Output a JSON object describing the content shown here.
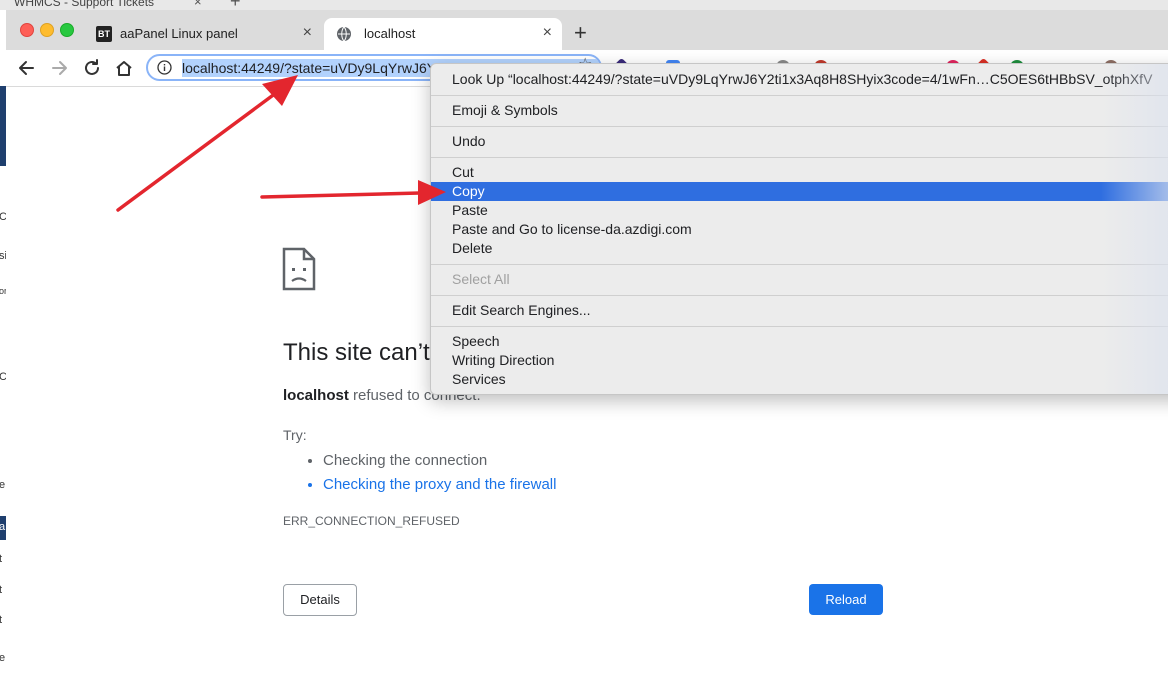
{
  "background_window": {
    "tab_title": "WHMCS - Support Tickets",
    "tab_close": "×",
    "new_tab": "+"
  },
  "browser": {
    "tabs": [
      {
        "favicon": "BT",
        "title": "aaPanel Linux panel",
        "close": "×",
        "active": false
      },
      {
        "favicon": "globe-icon",
        "title": "localhost",
        "close": "×",
        "active": true
      }
    ],
    "new_tab_label": "+",
    "address_bar": {
      "url": "localhost:44249/?state=uVDy9LqYrwJ6Y2ti1x3Aq8H8SHyix3code=4/1wFn",
      "selected": true,
      "star": "☆"
    }
  },
  "page": {
    "title": "This site can’t be reached",
    "host": "localhost",
    "host_suffix": " refused to connect.",
    "try_label": "Try:",
    "suggestions": [
      {
        "text": "Checking the connection",
        "link": false
      },
      {
        "text": "Checking the proxy and the firewall",
        "link": true
      }
    ],
    "error_code": "ERR_CONNECTION_REFUSED",
    "details_button": "Details",
    "reload_button": "Reload"
  },
  "context_menu": {
    "look_up": "Look Up “localhost:44249/?state=uVDy9LqYrwJ6Y2ti1x3Aq8H8SHyix3code=4/1wFn…C5OES6tHBbSV_otphXfV",
    "emoji": "Emoji & Symbols",
    "undo": "Undo",
    "cut": "Cut",
    "copy": "Copy",
    "paste": "Paste",
    "paste_go": "Paste and Go to license-da.azdigi.com",
    "delete": "Delete",
    "select_all": "Select All",
    "edit_search": "Edit Search Engines...",
    "speech": "Speech",
    "writing_direction": "Writing Direction",
    "services": "Services"
  },
  "colors": {
    "accent_blue": "#1a73e8",
    "menu_highlight": "#2f6ee0",
    "annotation_red": "#e3262e"
  },
  "left_slice_chars": [
    "u",
    "C",
    "si",
    "or",
    "C",
    "e",
    "a",
    "t",
    "t",
    "t",
    "e"
  ]
}
